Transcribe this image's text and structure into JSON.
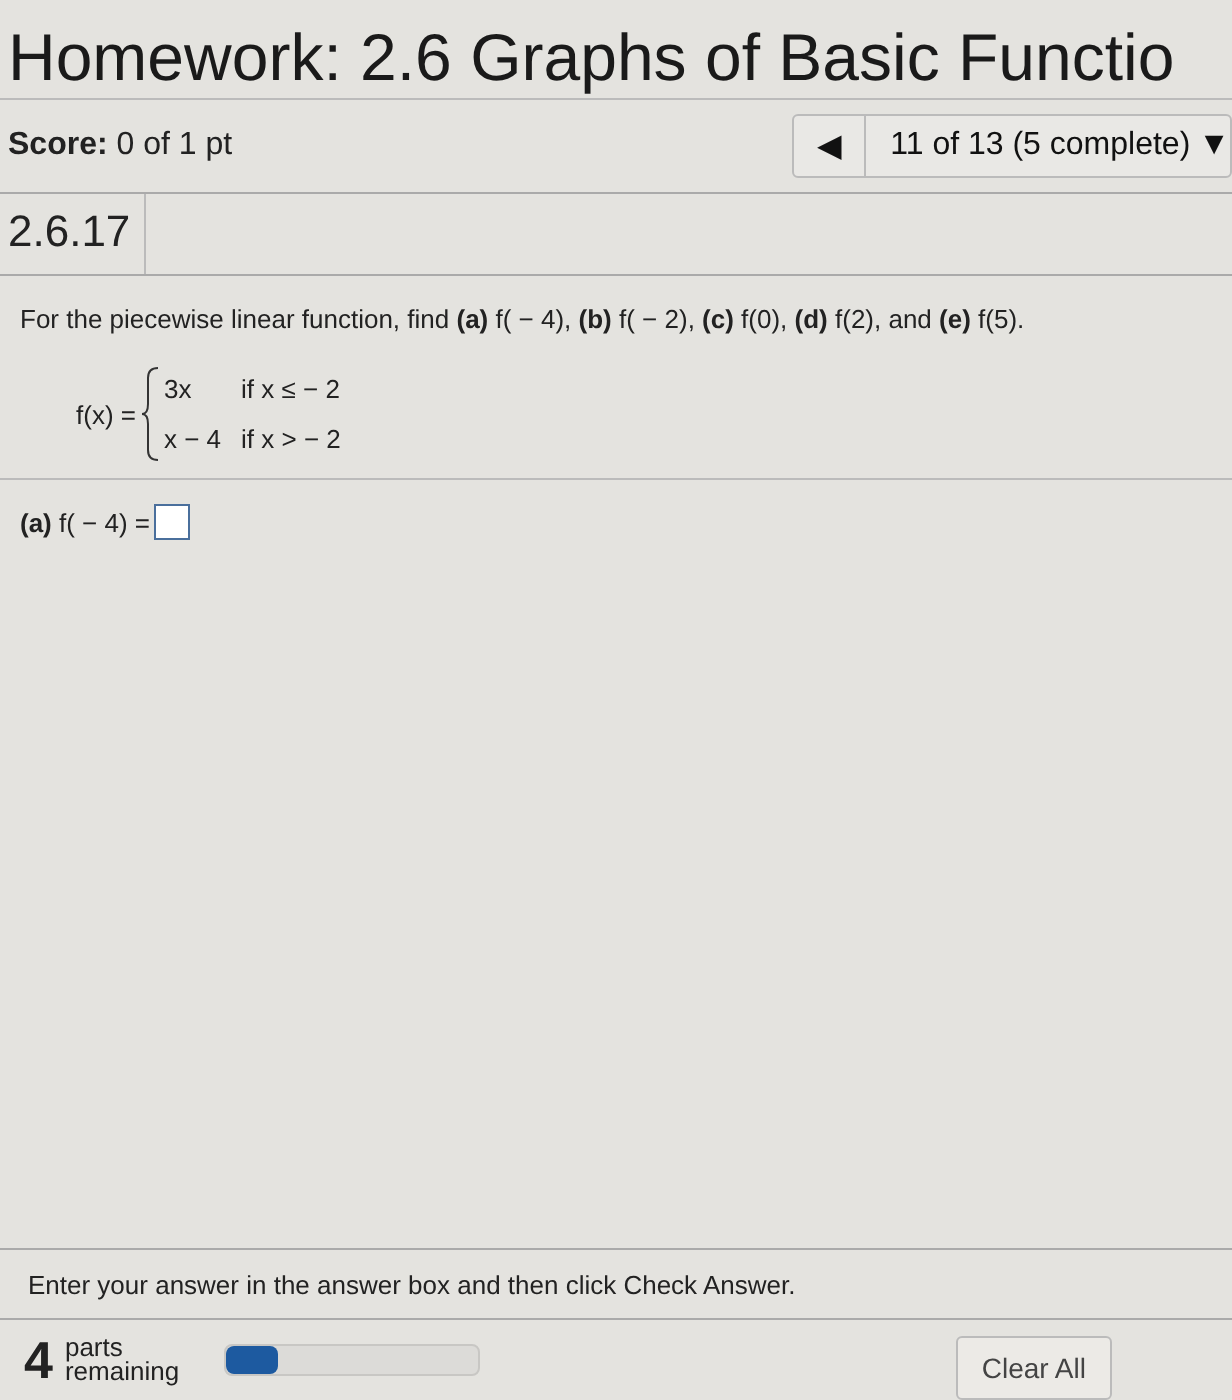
{
  "title": "Homework: 2.6 Graphs of Basic Functio",
  "score": {
    "label": "Score:",
    "value": "0 of 1 pt"
  },
  "navigator": {
    "prev": "◀",
    "position": "11 of 13 (5 complete)",
    "caret": "▼"
  },
  "question_number": "2.6.17",
  "question": "For the piecewise linear function, find **(a)** f( − 4), **(b)** f( − 2), **(c)** f(0), **(d)** f(2), and **(e)** f(5).",
  "function": {
    "name": "f(x) =",
    "pieces": [
      {
        "expression": "3x",
        "condition": "if x ≤ − 2"
      },
      {
        "expression": "x − 4",
        "condition": "if x > − 2"
      }
    ]
  },
  "answer": {
    "label": "**(a)** f( − 4) ="
  },
  "instruction": "Enter your answer in the answer box and then click Check Answer.",
  "footer": {
    "parts_count": "4",
    "parts_label": "parts remaining",
    "progress": {
      "level": 0.2
    },
    "clear_button": "Clear All"
  }
}
